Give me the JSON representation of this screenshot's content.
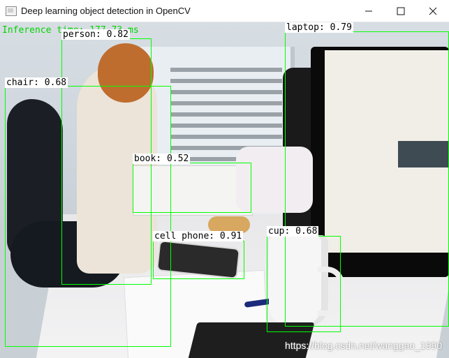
{
  "window": {
    "title": "Deep learning object detection in OpenCV",
    "icons": {
      "app": "opencv-window-icon",
      "minimize": "minimize-icon",
      "maximize": "maximize-icon",
      "close": "close-icon"
    }
  },
  "overlay": {
    "inference_text": "Inference time: 177.73 ms",
    "watermark": "https://blog.csdn.net/wanggao_1990",
    "box_color": "#00ff00"
  },
  "detections": {
    "person": {
      "label": "person: 0.82"
    },
    "chair": {
      "label": "chair: 0.68"
    },
    "laptop": {
      "label": "laptop: 0.79"
    },
    "book": {
      "label": "book: 0.52"
    },
    "cell_phone": {
      "label": "cell phone: 0.91"
    },
    "cup": {
      "label": "cup: 0.68"
    }
  }
}
